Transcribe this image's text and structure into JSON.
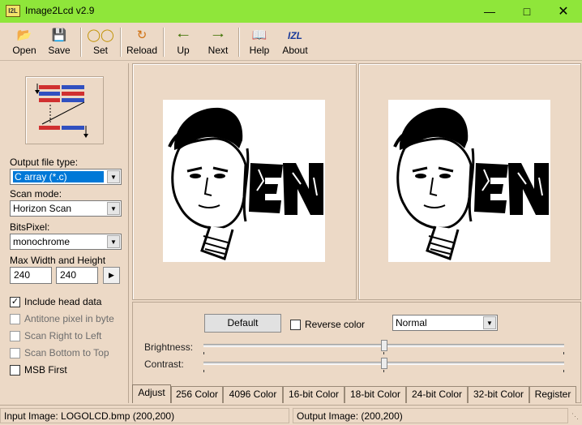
{
  "window": {
    "title": "Image2Lcd v2.9",
    "icon_text": "I2L"
  },
  "toolbar": {
    "open": "Open",
    "save": "Save",
    "set": "Set",
    "reload": "Reload",
    "up": "Up",
    "next": "Next",
    "help": "Help",
    "about": "About",
    "about_icon_text": "IZL"
  },
  "left": {
    "output_type_label": "Output file type:",
    "output_type_value": "C array (*.c)",
    "scan_mode_label": "Scan mode:",
    "scan_mode_value": "Horizon Scan",
    "bits_pixel_label": "BitsPixel:",
    "bits_pixel_value": "monochrome",
    "max_size_label": "Max Width and Height",
    "max_width": "240",
    "max_height": "240",
    "checkboxes": [
      {
        "label": "Include head data",
        "checked": true
      },
      {
        "label": "Antitone pixel in byte",
        "checked": false
      },
      {
        "label": "Scan Right to Left",
        "checked": false
      },
      {
        "label": "Scan Bottom to Top",
        "checked": false
      },
      {
        "label": "MSB First",
        "checked": false
      }
    ]
  },
  "preview": {
    "logo_text": "EN"
  },
  "adjust": {
    "default_button": "Default",
    "reverse_color": "Reverse color",
    "mode_value": "Normal",
    "brightness_label": "Brightness:",
    "contrast_label": "Contrast:",
    "brightness_level": 0.5,
    "contrast_level": 0.5
  },
  "tabs": [
    "Adjust",
    "256 Color",
    "4096 Color",
    "16-bit Color",
    "18-bit Color",
    "24-bit Color",
    "32-bit Color",
    "Register"
  ],
  "status": {
    "input": "Input Image: LOGOLCD.bmp (200,200)",
    "output": "Output Image: (200,200)"
  },
  "colors": {
    "titlebar": "#8fe63a",
    "panel": "#ecd9c6",
    "selection": "#0078d7"
  }
}
